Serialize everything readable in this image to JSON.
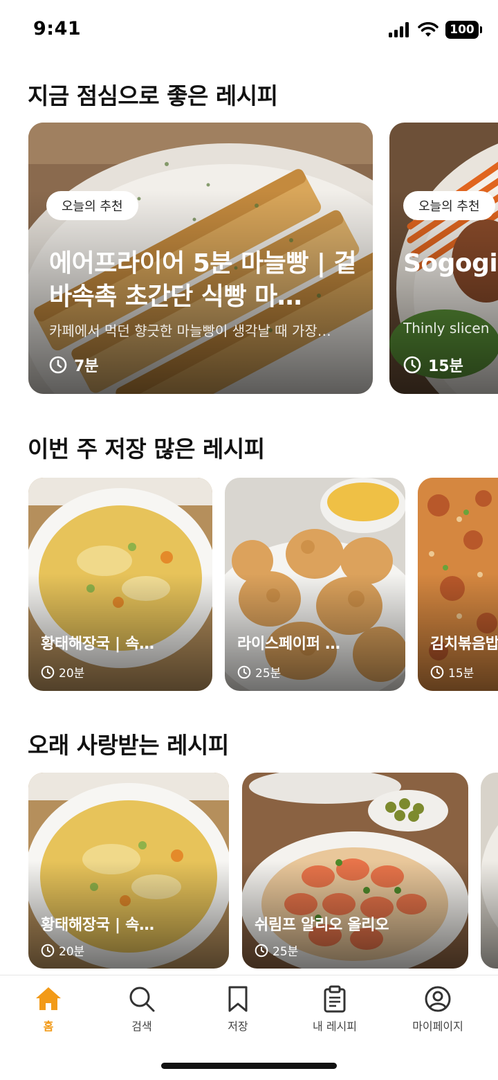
{
  "status_bar": {
    "time": "9:41",
    "battery": "100"
  },
  "sections": [
    {
      "title": "지금 점심으로 좋은 레시피"
    },
    {
      "title": "이번 주 저장 많은 레시피"
    },
    {
      "title": "오래 사랑받는 레시피"
    }
  ],
  "hero_cards": [
    {
      "badge": "오늘의 추천",
      "title": "에어프라이어 5분 마늘빵 | 겉바속촉 초간단 식빵 마…",
      "description": "카페에서 먹던 향긋한 마늘빵이 생각날 때 가장…",
      "time": "7분",
      "image": "garlic-bread-photo"
    },
    {
      "badge": "오늘의 추천",
      "title": "Sogogi (Korean",
      "description": "Thinly slicen",
      "time": "15분",
      "image": "bibimbap-photo"
    }
  ],
  "weekly_cards": [
    {
      "title": "황태해장국 | 속…",
      "time": "20분",
      "image": "hwangtae-soup-photo"
    },
    {
      "title": "라이스페이퍼 …",
      "time": "25분",
      "image": "fried-chicken-photo"
    },
    {
      "title": "김치볶음밥",
      "time": "15분",
      "image": "kimchi-fried-rice-photo"
    }
  ],
  "classic_cards": [
    {
      "title": "황태해장국 | 속…",
      "time": "20분",
      "image": "hwangtae-soup-photo"
    },
    {
      "title": "쉬림프 알리오 올리오",
      "time": "25분",
      "image": "shrimp-aglio-olio-photo"
    },
    {
      "title": "",
      "time": "",
      "image": "partial-card-photo"
    }
  ],
  "bottom_nav": [
    {
      "label": "홈",
      "icon": "home-icon",
      "active": true
    },
    {
      "label": "검색",
      "icon": "search-icon",
      "active": false
    },
    {
      "label": "저장",
      "icon": "bookmark-icon",
      "active": false
    },
    {
      "label": "내 레시피",
      "icon": "clipboard-icon",
      "active": false
    },
    {
      "label": "마이페이지",
      "icon": "user-circle-icon",
      "active": false
    }
  ],
  "colors": {
    "accent": "#F29A18",
    "text": "#111111",
    "nav_inactive": "#444444"
  }
}
